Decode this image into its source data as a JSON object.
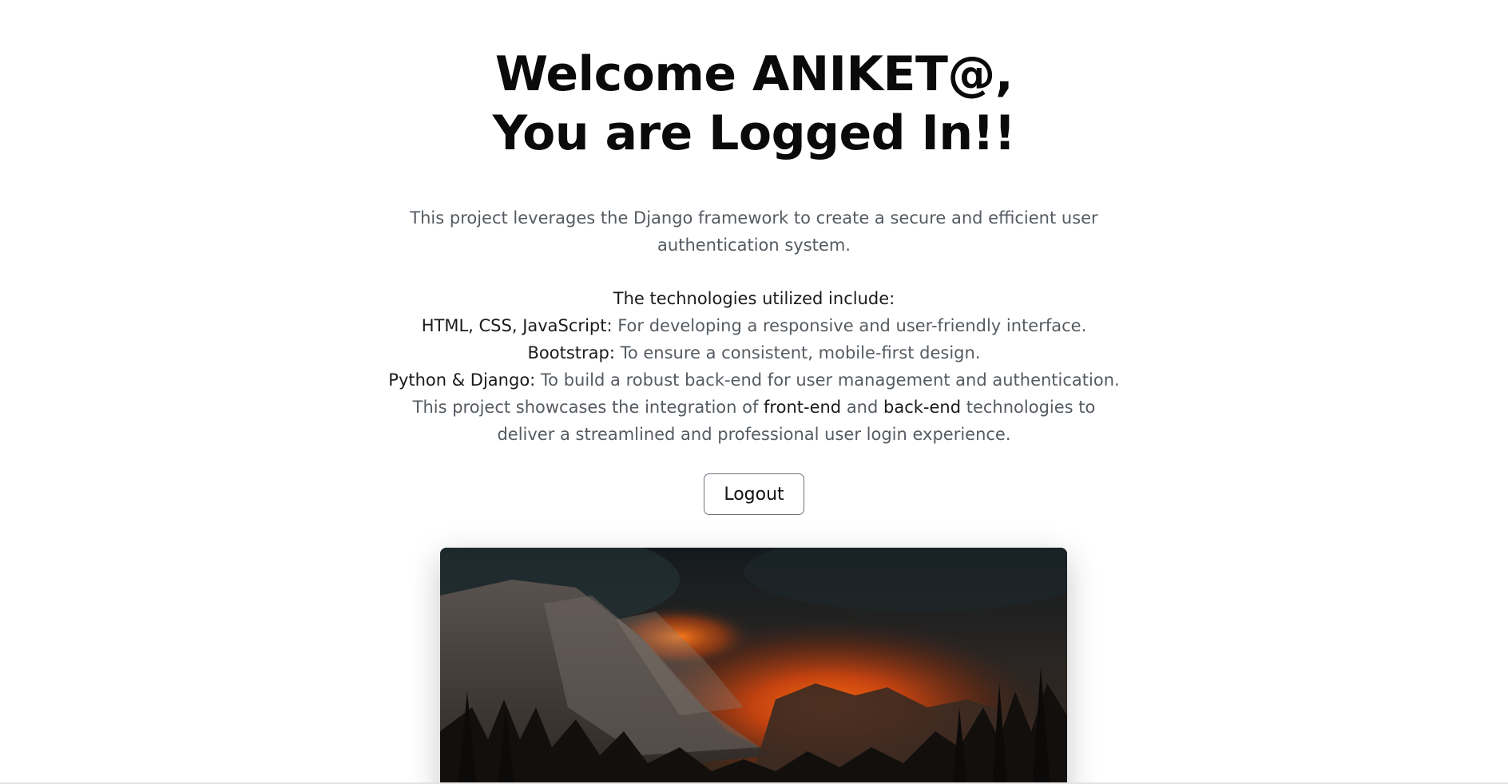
{
  "hero": {
    "title_line1": "Welcome ANIKET@,",
    "title_line2": "You are Logged In!!",
    "description": "This project leverages the Django framework to create a secure and efficient user authentication system."
  },
  "technologies": {
    "heading": "The technologies utilized include:",
    "items": [
      {
        "name": "HTML, CSS, JavaScript:",
        "detail": " For developing a responsive and user-friendly interface."
      },
      {
        "name": "Bootstrap:",
        "detail": " To ensure a consistent, mobile-first design."
      },
      {
        "name": "Python & Django:",
        "detail": " To build a robust back-end for user management and authentication."
      }
    ],
    "summary_part1": "This project showcases the integration of ",
    "summary_frontend": "front-end",
    "summary_and": " and ",
    "summary_backend": "back-end",
    "summary_part2": " technologies to deliver a streamlined and professional user login experience."
  },
  "actions": {
    "logout_label": "Logout"
  },
  "image": {
    "subject": "mountain-landscape-with-fiery-sunset-clouds-and-forest"
  }
}
